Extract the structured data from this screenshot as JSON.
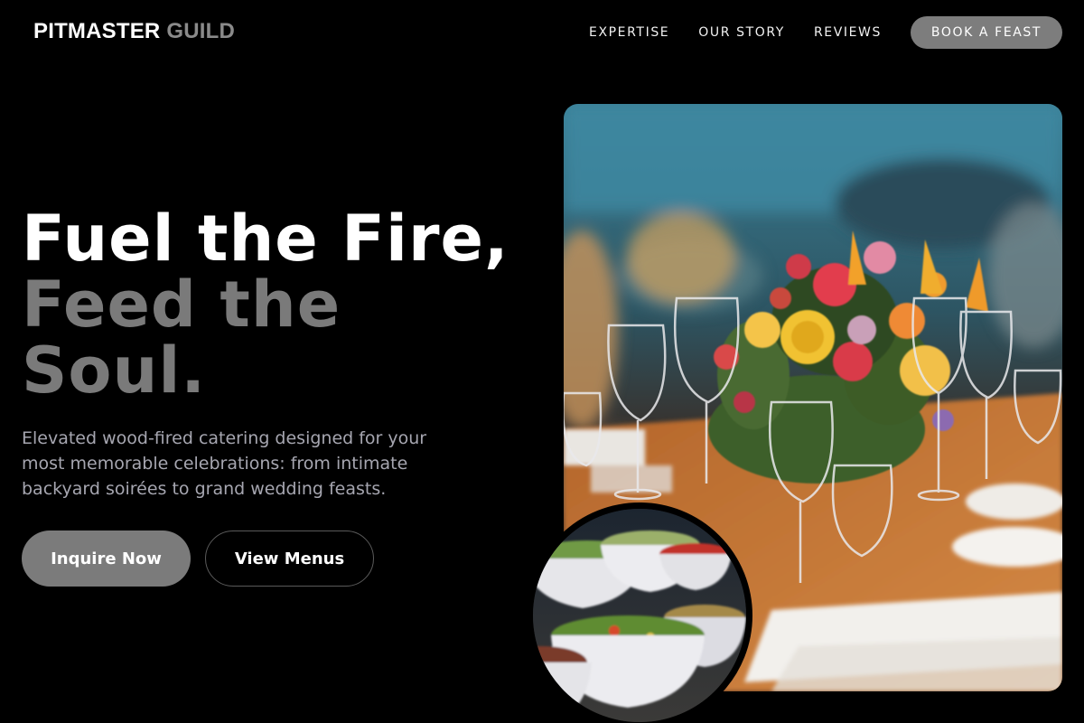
{
  "brand": {
    "part1": "PITMASTER",
    "part2": "GUILD"
  },
  "nav": {
    "items": [
      {
        "label": "EXPERTISE"
      },
      {
        "label": "OUR STORY"
      },
      {
        "label": "REVIEWS"
      }
    ],
    "cta_label": "BOOK A FEAST"
  },
  "hero": {
    "headline_line1": "Fuel the Fire,",
    "headline_line2": "Feed the Soul.",
    "subtitle": "Elevated wood-fired catering designed for your most memorable celebrations: from intimate backyard soirées to grand wedding feasts.",
    "primary_button": "Inquire Now",
    "secondary_button": "View Menus"
  },
  "colors": {
    "background": "#000000",
    "accent_gray": "#7b7b7b",
    "muted_text": "#a6a6b0"
  },
  "images": {
    "main": "banquet-table-with-floral-centerpiece",
    "inset": "salad-bowls-buffet"
  }
}
